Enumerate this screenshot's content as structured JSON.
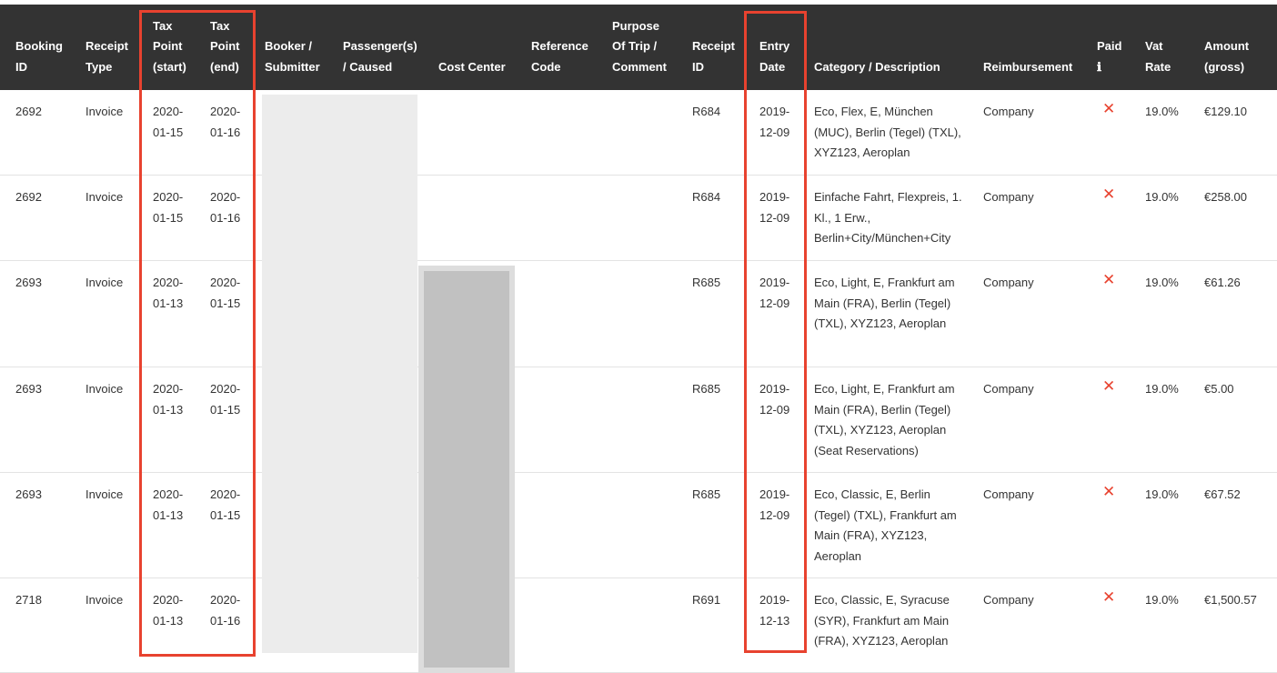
{
  "table": {
    "headers": [
      {
        "key": "booking_id",
        "label": "Booking\nID"
      },
      {
        "key": "receipt_type",
        "label": "Receipt\nType"
      },
      {
        "key": "tax_start",
        "label": "Tax\nPoint\n(start)"
      },
      {
        "key": "tax_end",
        "label": "Tax\nPoint\n(end)"
      },
      {
        "key": "booker",
        "label": "Booker /\nSubmitter"
      },
      {
        "key": "passengers",
        "label": "Passenger(s)\n/ Caused"
      },
      {
        "key": "cost_center",
        "label": "Cost Center"
      },
      {
        "key": "reference",
        "label": "Reference\nCode"
      },
      {
        "key": "purpose",
        "label": "Purpose\nOf Trip /\nComment"
      },
      {
        "key": "receipt_id",
        "label": "Receipt\nID"
      },
      {
        "key": "entry_date",
        "label": "Entry\nDate"
      },
      {
        "key": "category",
        "label": "Category / Description"
      },
      {
        "key": "reimbursement",
        "label": "Reimbursement"
      },
      {
        "key": "paid",
        "label": "Paid\nℹ"
      },
      {
        "key": "vat",
        "label": "Vat\nRate"
      },
      {
        "key": "amount",
        "label": "Amount\n(gross)"
      }
    ],
    "rows": [
      {
        "booking_id": "2692",
        "receipt_type": "Invoice",
        "tax_start": "2020-\n01-15",
        "tax_end": "2020-\n01-16",
        "receipt_id": "R684",
        "entry_date": "2019-\n12-09",
        "category": "Eco, Flex, E, München\n(MUC), Berlin (Tegel) (TXL),\nXYZ123, Aeroplan",
        "reimbursement": "Company",
        "paid": "✕",
        "vat": "19.0%",
        "amount": "€129.10"
      },
      {
        "booking_id": "2692",
        "receipt_type": "Invoice",
        "tax_start": "2020-\n01-15",
        "tax_end": "2020-\n01-16",
        "receipt_id": "R684",
        "entry_date": "2019-\n12-09",
        "category": "Einfache Fahrt, Flexpreis, 1.\nKl., 1 Erw.,\nBerlin+City/München+City",
        "reimbursement": "Company",
        "paid": "✕",
        "vat": "19.0%",
        "amount": "€258.00"
      },
      {
        "booking_id": "2693",
        "receipt_type": "Invoice",
        "tax_start": "2020-\n01-13",
        "tax_end": "2020-\n01-15",
        "receipt_id": "R685",
        "entry_date": "2019-\n12-09",
        "category": "Eco, Light, E, Frankfurt am\nMain (FRA), Berlin (Tegel)\n(TXL), XYZ123, Aeroplan",
        "reimbursement": "Company",
        "paid": "✕",
        "vat": "19.0%",
        "amount": "€61.26"
      },
      {
        "booking_id": "2693",
        "receipt_type": "Invoice",
        "tax_start": "2020-\n01-13",
        "tax_end": "2020-\n01-15",
        "receipt_id": "R685",
        "entry_date": "2019-\n12-09",
        "category": "Eco, Light, E, Frankfurt am\nMain (FRA), Berlin (Tegel)\n(TXL), XYZ123, Aeroplan\n(Seat Reservations)",
        "reimbursement": "Company",
        "paid": "✕",
        "vat": "19.0%",
        "amount": "€5.00"
      },
      {
        "booking_id": "2693",
        "receipt_type": "Invoice",
        "tax_start": "2020-\n01-13",
        "tax_end": "2020-\n01-15",
        "receipt_id": "R685",
        "entry_date": "2019-\n12-09",
        "category": "Eco, Classic, E, Berlin\n(Tegel) (TXL), Frankfurt am\nMain (FRA), XYZ123,\nAeroplan",
        "reimbursement": "Company",
        "paid": "✕",
        "vat": "19.0%",
        "amount": "€67.52"
      },
      {
        "booking_id": "2718",
        "receipt_type": "Invoice",
        "tax_start": "2020-\n01-13",
        "tax_end": "2020-\n01-16",
        "receipt_id": "R691",
        "entry_date": "2019-\n12-13",
        "category": "Eco, Classic, E, Syracuse\n(SYR), Frankfurt am Main\n(FRA), XYZ123, Aeroplan",
        "reimbursement": "Company",
        "paid": "✕",
        "vat": "19.0%",
        "amount": "€1,500.57"
      }
    ]
  },
  "colors": {
    "header_bg": "#333333",
    "highlight": "#e8422f",
    "unpaid_mark": "#e8422f"
  }
}
